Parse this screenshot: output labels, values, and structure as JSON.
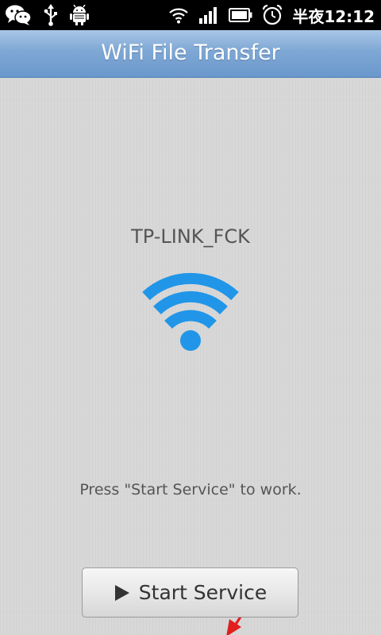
{
  "status_bar": {
    "time": "半夜12:12",
    "left_icons": [
      "wechat-icon",
      "usb-icon",
      "android-debug-icon"
    ],
    "right_icons": [
      "wifi-signal-icon",
      "cell-signal-icon",
      "battery-icon",
      "alarm-clock-icon"
    ]
  },
  "app": {
    "title": "WiFi File Transfer"
  },
  "main": {
    "network_name": "TP-LINK_FCK",
    "wifi_icon": "wifi-icon",
    "wifi_color": "#2196e8",
    "hint": "Press \"Start Service\" to work.",
    "start_button": {
      "icon": "play-icon",
      "label": "Start Service"
    },
    "annotation_arrow_color": "#e0201f"
  }
}
